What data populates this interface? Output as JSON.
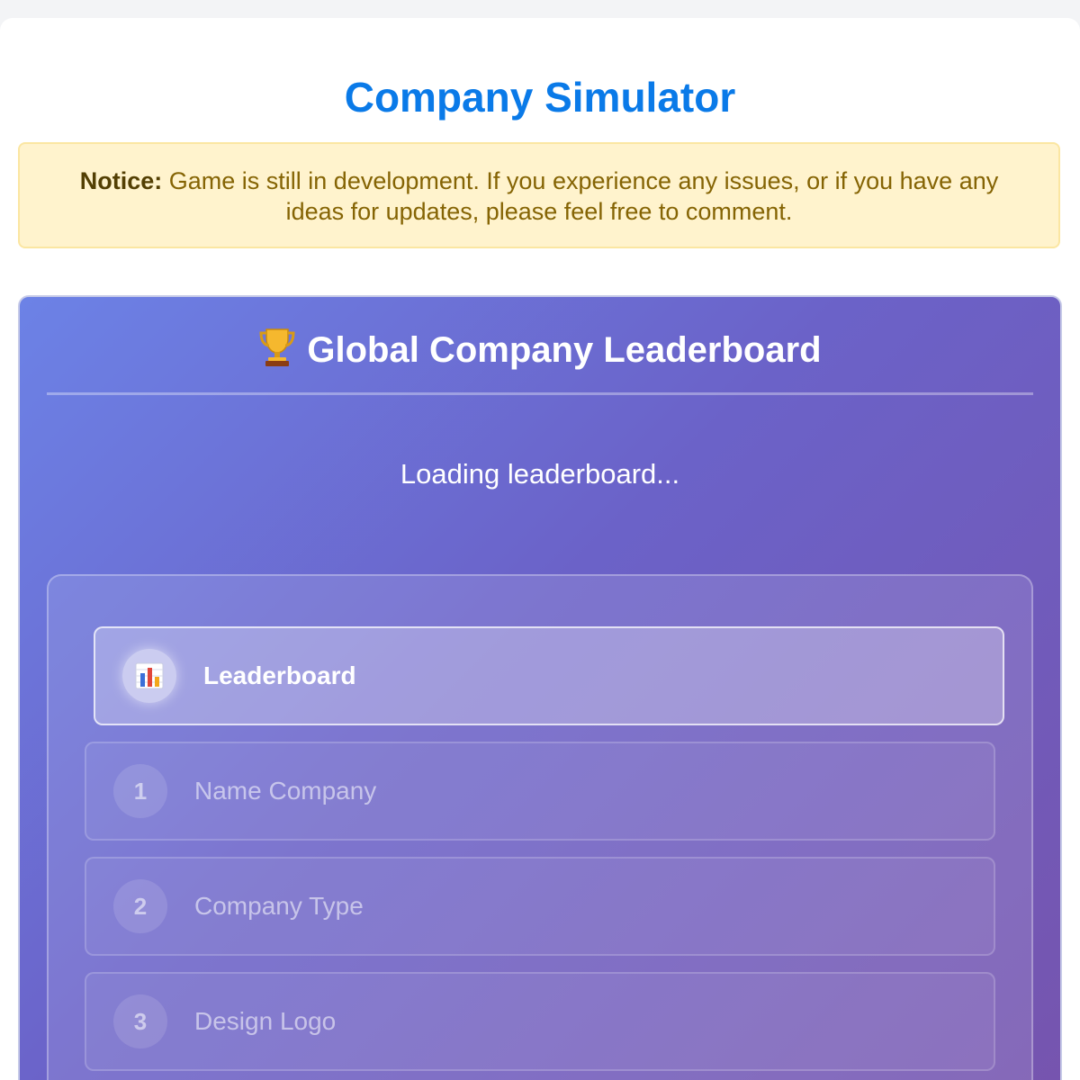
{
  "app": {
    "title": "Company Simulator"
  },
  "notice": {
    "label": "Notice:",
    "text": " Game is still in development. If you experience any issues, or if you have any ideas for updates, please feel free to comment."
  },
  "leaderboard": {
    "title": "Global Company Leaderboard",
    "icon": "trophy-icon",
    "loading_text": "Loading leaderboard..."
  },
  "menu": {
    "active": {
      "label": "Leaderboard",
      "icon": "bar-chart-icon"
    },
    "steps": [
      {
        "number": "1",
        "label": "Name Company"
      },
      {
        "number": "2",
        "label": "Company Type"
      },
      {
        "number": "3",
        "label": "Design Logo"
      }
    ]
  },
  "colors": {
    "title": "#0a7ae8",
    "notice_bg": "#fff3cd",
    "notice_text": "#856404",
    "board_gradient_start": "#6c82e6",
    "board_gradient_end": "#7654ae"
  }
}
